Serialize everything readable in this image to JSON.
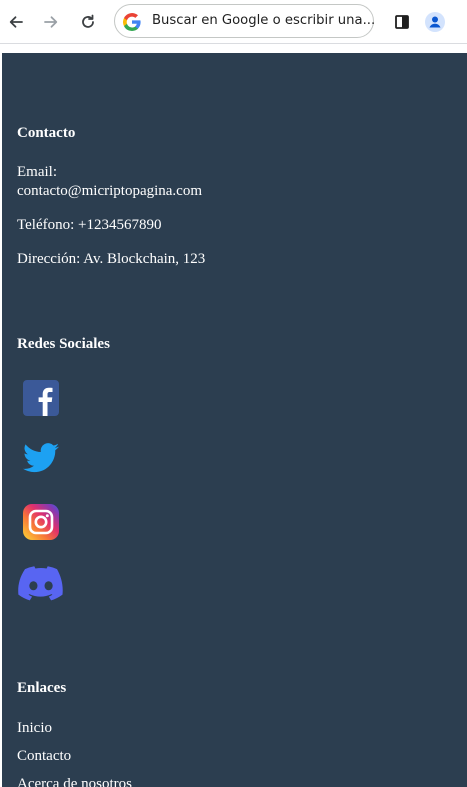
{
  "browser": {
    "address_placeholder": "Buscar en Google o escribir una..."
  },
  "contact": {
    "heading": "Contacto",
    "email_label": "Email:",
    "email_value": "contacto@micriptopagina.com",
    "phone": "Teléfono: +1234567890",
    "address": "Dirección: Av. Blockchain, 123"
  },
  "social": {
    "heading": "Redes Sociales",
    "icons": [
      "facebook-icon",
      "twitter-icon",
      "instagram-icon",
      "discord-icon"
    ],
    "colors": {
      "facebook": "#3b5998",
      "twitter": "#1da1f2",
      "discord": "#5865f2"
    }
  },
  "links": {
    "heading": "Enlaces",
    "items": [
      "Inicio",
      "Contacto",
      "Acerca de nosotros"
    ]
  },
  "theme": {
    "page_bg": "#2c3e50",
    "text": "#ffffff"
  }
}
